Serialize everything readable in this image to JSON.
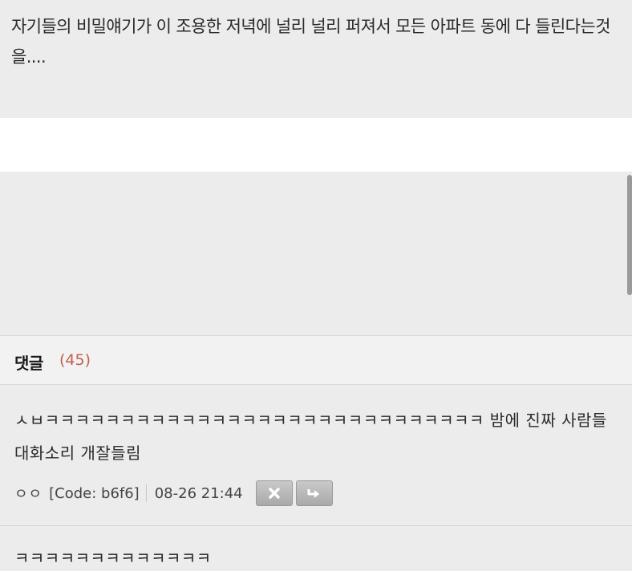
{
  "post": {
    "text": "자기들의 비밀얘기가 이 조용한 저녁에 널리 널리 퍼져서 모든 아파트 동에 다 들린다는것을...."
  },
  "comments_section": {
    "title": "댓글",
    "count": "(45)"
  },
  "comments": [
    {
      "text": "ㅅㅂㅋㅋㅋㅋㅋㅋㅋㅋㅋㅋㅋㅋㅋㅋㅋㅋㅋㅋㅋㅋㅋㅋㅋㅋㅋㅋㅋㅋㅋ 밤에 진짜 사람들 대화소리 개잘들림",
      "author": "ㅇㅇ",
      "code": "[Code: b6f6]",
      "time": "08-26 21:44",
      "delete_icon": "close-icon",
      "reply_icon": "reply-arrow-icon"
    },
    {
      "text": "ㅋㅋㅋㅋㅋㅋㅋㅋㅋㅋㅋㅋㅋ"
    }
  ],
  "colors": {
    "count": "#c0604f",
    "background": "#ececec"
  }
}
